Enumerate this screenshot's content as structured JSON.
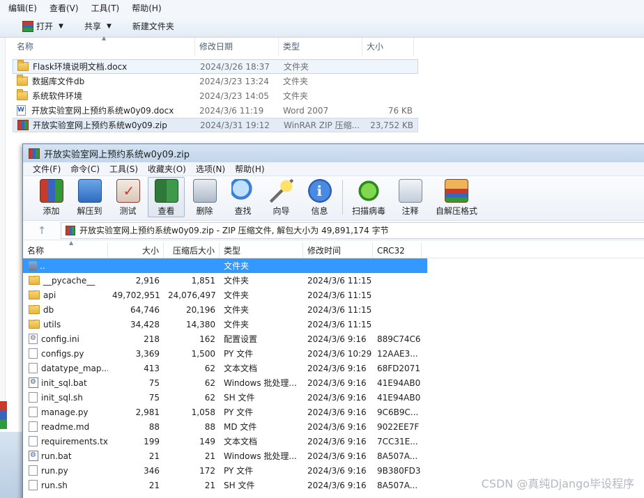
{
  "explorer": {
    "menu": [
      "编辑(E)",
      "查看(V)",
      "工具(T)",
      "帮助(H)"
    ],
    "toolbar": {
      "open": "打开",
      "share": "共享",
      "new_folder": "新建文件夹"
    },
    "columns": {
      "name": "名称",
      "modified": "修改日期",
      "type": "类型",
      "size": "大小"
    },
    "files": [
      {
        "name": "Flask环境说明文档.docx",
        "date": "2024/3/26 18:37",
        "type": "文件夹",
        "size": "",
        "icon": "folder-icon"
      },
      {
        "name": "数据库文件db",
        "date": "2024/3/23 13:24",
        "type": "文件夹",
        "size": "",
        "icon": "folder-icon"
      },
      {
        "name": "系统软件环境",
        "date": "2024/3/23 14:05",
        "type": "文件夹",
        "size": "",
        "icon": "folder-icon"
      },
      {
        "name": "开放实验室网上预约系统w0y09.docx",
        "date": "2024/3/6 11:19",
        "type": "Word 2007",
        "size": "76 KB",
        "icon": "word-doc-icon"
      },
      {
        "name": "开放实验室网上预约系统w0y09.zip",
        "date": "2024/3/31 19:12",
        "type": "WinRAR ZIP 压缩...",
        "size": "23,752 KB",
        "icon": "winrar-zip-icon"
      }
    ]
  },
  "winrar": {
    "title": "开放实验室网上预约系统w0y09.zip",
    "menu": [
      "文件(F)",
      "命令(C)",
      "工具(S)",
      "收藏夹(O)",
      "选项(N)",
      "帮助(H)"
    ],
    "toolbar": [
      "添加",
      "解压到",
      "测试",
      "查看",
      "删除",
      "查找",
      "向导",
      "信息",
      "扫描病毒",
      "注释",
      "自解压格式"
    ],
    "address": "开放实验室网上预约系统w0y09.zip - ZIP 压缩文件, 解包大小为 49,891,174 字节",
    "columns": {
      "name": "名称",
      "size": "大小",
      "packed": "压缩后大小",
      "type": "类型",
      "modified": "修改时间",
      "crc": "CRC32"
    },
    "rows": [
      {
        "name": "..",
        "size": "",
        "packed": "",
        "type": "文件夹",
        "modified": "",
        "crc": "",
        "icon": "up-folder-icon"
      },
      {
        "name": "__pycache__",
        "size": "2,916",
        "packed": "1,851",
        "type": "文件夹",
        "modified": "2024/3/6 11:15",
        "crc": "",
        "icon": "folder-icon"
      },
      {
        "name": "api",
        "size": "49,702,951",
        "packed": "24,076,497",
        "type": "文件夹",
        "modified": "2024/3/6 11:15",
        "crc": "",
        "icon": "folder-icon"
      },
      {
        "name": "db",
        "size": "64,746",
        "packed": "20,196",
        "type": "文件夹",
        "modified": "2024/3/6 11:15",
        "crc": "",
        "icon": "folder-icon"
      },
      {
        "name": "utils",
        "size": "34,428",
        "packed": "14,380",
        "type": "文件夹",
        "modified": "2024/3/6 11:15",
        "crc": "",
        "icon": "folder-icon"
      },
      {
        "name": "config.ini",
        "size": "218",
        "packed": "162",
        "type": "配置设置",
        "modified": "2024/3/6 9:16",
        "crc": "889C74C6",
        "icon": "ini-file-icon"
      },
      {
        "name": "configs.py",
        "size": "3,369",
        "packed": "1,500",
        "type": "PY 文件",
        "modified": "2024/3/6 10:29",
        "crc": "12AAE3...",
        "icon": "file-icon"
      },
      {
        "name": "datatype_map....",
        "size": "413",
        "packed": "62",
        "type": "文本文档",
        "modified": "2024/3/6 9:16",
        "crc": "68FD2071",
        "icon": "file-icon"
      },
      {
        "name": "init_sql.bat",
        "size": "75",
        "packed": "62",
        "type": "Windows 批处理...",
        "modified": "2024/3/6 9:16",
        "crc": "41E94AB0",
        "icon": "bat-file-icon"
      },
      {
        "name": "init_sql.sh",
        "size": "75",
        "packed": "62",
        "type": "SH 文件",
        "modified": "2024/3/6 9:16",
        "crc": "41E94AB0",
        "icon": "file-icon"
      },
      {
        "name": "manage.py",
        "size": "2,981",
        "packed": "1,058",
        "type": "PY 文件",
        "modified": "2024/3/6 9:16",
        "crc": "9C6B9C...",
        "icon": "file-icon"
      },
      {
        "name": "readme.md",
        "size": "88",
        "packed": "88",
        "type": "MD 文件",
        "modified": "2024/3/6 9:16",
        "crc": "9022EE7F",
        "icon": "file-icon"
      },
      {
        "name": "requirements.txt",
        "size": "199",
        "packed": "149",
        "type": "文本文档",
        "modified": "2024/3/6 9:16",
        "crc": "7CC31E...",
        "icon": "file-icon"
      },
      {
        "name": "run.bat",
        "size": "21",
        "packed": "21",
        "type": "Windows 批处理...",
        "modified": "2024/3/6 9:16",
        "crc": "8A507A...",
        "icon": "bat-file-icon"
      },
      {
        "name": "run.py",
        "size": "346",
        "packed": "172",
        "type": "PY 文件",
        "modified": "2024/3/6 9:16",
        "crc": "9B380FD3",
        "icon": "file-icon"
      },
      {
        "name": "run.sh",
        "size": "21",
        "packed": "21",
        "type": "SH 文件",
        "modified": "2024/3/6 9:16",
        "crc": "8A507A...",
        "icon": "file-icon"
      }
    ]
  },
  "watermark": "CSDN @真纯Django毕设程序"
}
